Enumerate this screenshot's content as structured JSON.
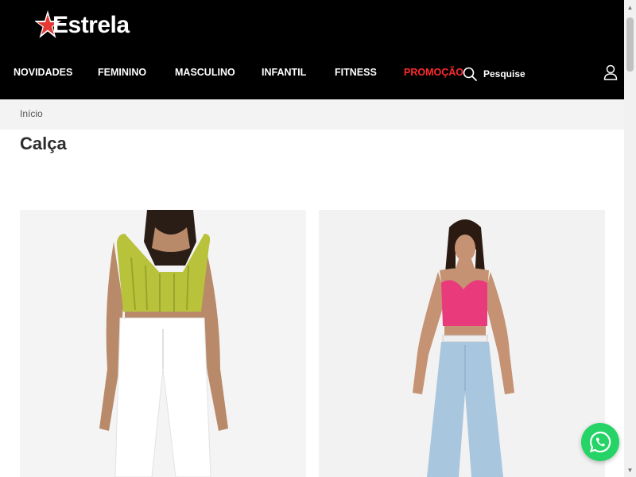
{
  "brand": {
    "name": "Estrela",
    "accent_color": "#e53935"
  },
  "nav": {
    "items": [
      {
        "label": "NOVIDADES"
      },
      {
        "label": "FEMININO"
      },
      {
        "label": "MASCULINO"
      },
      {
        "label": "INFANTIL"
      },
      {
        "label": "FITNESS"
      },
      {
        "label": "PROMOÇÃO"
      }
    ],
    "search_label": "Pesquise"
  },
  "breadcrumb": {
    "home": "Início"
  },
  "page": {
    "title": "Calça"
  },
  "colors": {
    "header_bg": "#000000",
    "promo": "#ff2b2b",
    "whatsapp": "#25d366"
  }
}
